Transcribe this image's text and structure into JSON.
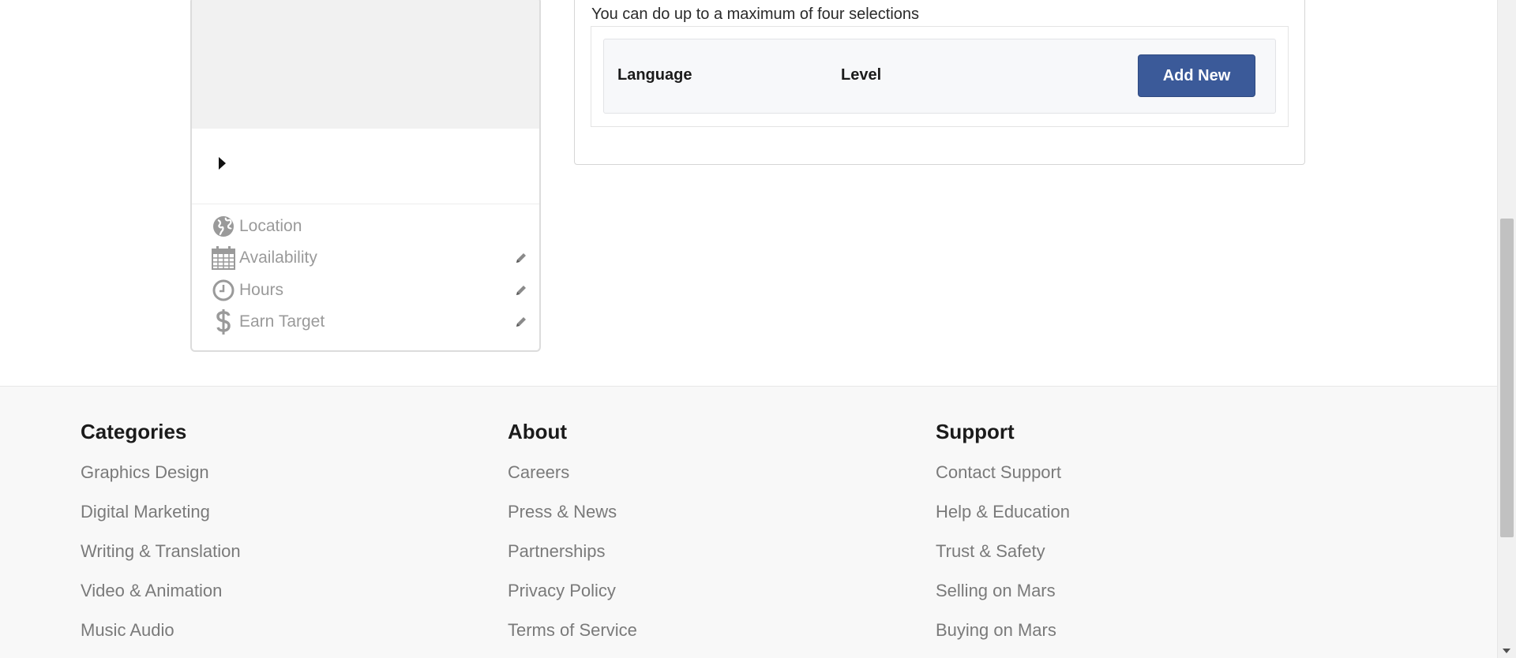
{
  "profile": {
    "details": [
      {
        "label": "Location",
        "icon": "globe-icon",
        "editable": false
      },
      {
        "label": "Availability",
        "icon": "calendar-icon",
        "editable": true
      },
      {
        "label": "Hours",
        "icon": "clock-icon",
        "editable": true
      },
      {
        "label": "Earn Target",
        "icon": "dollar-icon",
        "editable": true
      }
    ]
  },
  "languages": {
    "hint": "You can do up to a maximum of four selections",
    "column_language": "Language",
    "column_level": "Level",
    "add_label": "Add New",
    "accent_color": "#3b5a99"
  },
  "footer": {
    "columns": [
      {
        "title": "Categories",
        "links": [
          "Graphics Design",
          "Digital Marketing",
          "Writing & Translation",
          "Video & Animation",
          "Music Audio"
        ]
      },
      {
        "title": "About",
        "links": [
          "Careers",
          "Press & News",
          "Partnerships",
          "Privacy Policy",
          "Terms of Service"
        ]
      },
      {
        "title": "Support",
        "links": [
          "Contact Support",
          "Help & Education",
          "Trust & Safety",
          "Selling on Mars",
          "Buying on Mars"
        ]
      }
    ]
  }
}
